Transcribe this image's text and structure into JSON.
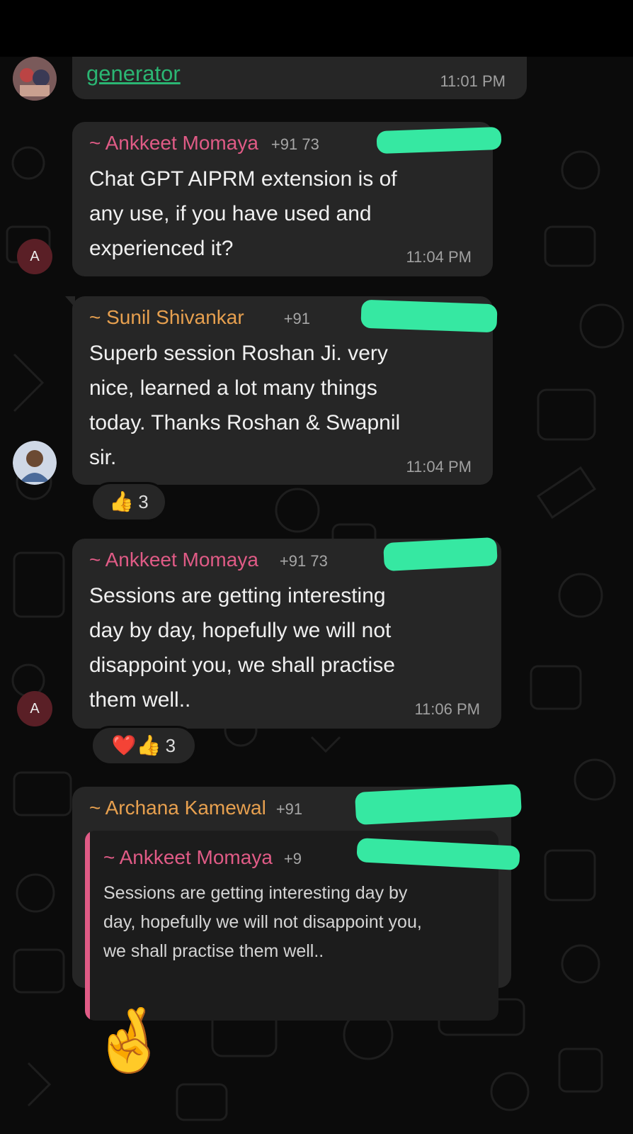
{
  "colors": {
    "background": "#0b0b0b",
    "bubble": "#262626",
    "redaction": "#36e8a2",
    "sender_orange": "#e7a04f",
    "sender_pink": "#e05b86"
  },
  "top_message": {
    "link_text": "generator",
    "time": "11:01 PM"
  },
  "messages": [
    {
      "avatar": "A",
      "sender": "~ Ankkeet Momaya",
      "phone": "+91 73",
      "text": "Chat GPT AIPRM extension is of\nany use, if you have used and\nexperienced it?",
      "time": "11:04 PM"
    },
    {
      "avatar_icon": "profile-photo",
      "sender": "~ Sunil Shivankar",
      "phone": "+91",
      "text": "Superb session Roshan Ji. very\nnice, learned a lot many things\ntoday. Thanks Roshan & Swapnil\nsir.",
      "time": "11:04 PM",
      "reaction": {
        "emoji": "👍",
        "count": "3"
      }
    },
    {
      "avatar": "A",
      "sender": "~ Ankkeet Momaya",
      "phone": "+91 73",
      "text": "Sessions are getting interesting\nday by day, hopefully we will not\ndisappoint you, we shall practise\nthem well..",
      "time": "11:06 PM",
      "reaction": {
        "emoji": "❤️👍",
        "count": "3"
      }
    },
    {
      "sender": "~ Archana Kamewal",
      "phone": "+91",
      "quoted": {
        "sender": "~ Ankkeet Momaya",
        "phone": "+9",
        "text": "Sessions are getting interesting day by\nday, hopefully we will not disappoint you,\nwe shall practise them well.."
      }
    }
  ],
  "last_emoji": "🤞"
}
